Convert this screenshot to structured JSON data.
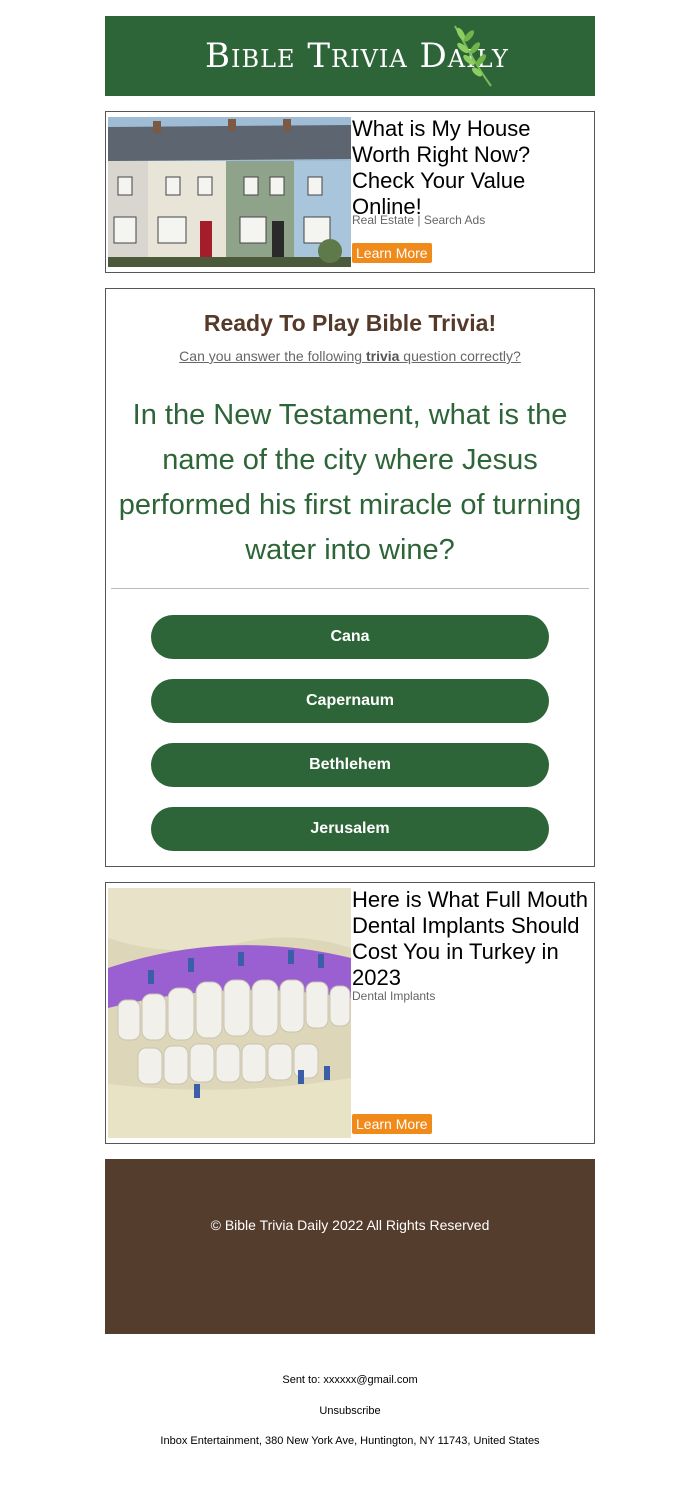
{
  "header": {
    "logo_text": "Bible Trivia Daily",
    "logo_icon": "leaf-icon",
    "bg_color": "#2e6538"
  },
  "ad_top": {
    "title": "What is My House Worth Right Now? Check Your Value Online!",
    "source": "Real Estate | Search Ads",
    "button": "Learn More",
    "image": "row-houses-photo"
  },
  "quiz": {
    "title": "Ready To Play Bible Trivia!",
    "subtitle_before": "Can you answer the following ",
    "subtitle_bold": "trivia",
    "subtitle_after": " question correctly?",
    "question": "In the New Testament, what is the name of the city where Jesus performed his first miracle of turning water into wine?",
    "answers": [
      "Cana",
      "Capernaum",
      "Bethlehem",
      "Jerusalem"
    ],
    "accent_color": "#2e6538"
  },
  "ad_bottom": {
    "title": "Here is What Full Mouth Dental Implants Should Cost You in Turkey in 2023",
    "source": "Dental Implants",
    "button": "Learn More",
    "image": "dental-implants-photo"
  },
  "footer": {
    "copyright": "© Bible Trivia Daily 2022 All Rights Reserved",
    "bg_color": "#553d2d"
  },
  "meta": {
    "sent_to": "Sent to: xxxxxx@gmail.com",
    "unsubscribe": "Unsubscribe",
    "address": "Inbox Entertainment, 380 New York Ave, Huntington, NY 11743, United States"
  },
  "button_color": "#f08a1a"
}
